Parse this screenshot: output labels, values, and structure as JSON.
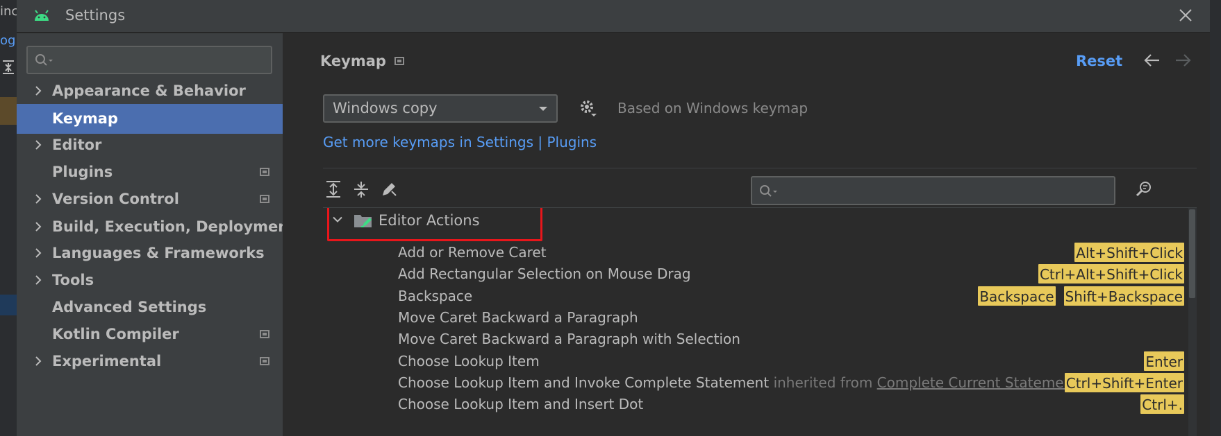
{
  "background": {
    "fragments": [
      "inc",
      "og"
    ]
  },
  "window": {
    "title": "Settings"
  },
  "sidebar": {
    "search_placeholder": "",
    "items": [
      {
        "label": "Appearance & Behavior",
        "expandable": true,
        "selected": false,
        "project_icon": false
      },
      {
        "label": "Keymap",
        "expandable": false,
        "selected": true,
        "project_icon": false
      },
      {
        "label": "Editor",
        "expandable": true,
        "selected": false,
        "project_icon": false
      },
      {
        "label": "Plugins",
        "expandable": false,
        "selected": false,
        "project_icon": true
      },
      {
        "label": "Version Control",
        "expandable": true,
        "selected": false,
        "project_icon": true
      },
      {
        "label": "Build, Execution, Deployment",
        "expandable": true,
        "selected": false,
        "project_icon": false
      },
      {
        "label": "Languages & Frameworks",
        "expandable": true,
        "selected": false,
        "project_icon": false
      },
      {
        "label": "Tools",
        "expandable": true,
        "selected": false,
        "project_icon": false
      },
      {
        "label": "Advanced Settings",
        "expandable": false,
        "selected": false,
        "project_icon": false
      },
      {
        "label": "Kotlin Compiler",
        "expandable": false,
        "selected": false,
        "project_icon": true
      },
      {
        "label": "Experimental",
        "expandable": true,
        "selected": false,
        "project_icon": true
      }
    ]
  },
  "main": {
    "heading": "Keymap",
    "reset_label": "Reset",
    "keymap_select": "Windows copy",
    "based_on": "Based on Windows keymap",
    "get_more_link": "Get more keymaps in Settings | Plugins",
    "tree_search_placeholder": "",
    "group": {
      "label": "Editor Actions",
      "expanded": true
    },
    "actions": [
      {
        "name": "Add or Remove Caret",
        "inherited": "",
        "inherited_from": "",
        "keys": [
          "Alt+Shift+Click"
        ]
      },
      {
        "name": "Add Rectangular Selection on Mouse Drag",
        "inherited": "",
        "inherited_from": "",
        "keys": [
          "Ctrl+Alt+Shift+Click"
        ]
      },
      {
        "name": "Backspace",
        "inherited": "",
        "inherited_from": "",
        "keys": [
          "Backspace",
          "Shift+Backspace"
        ]
      },
      {
        "name": "Move Caret Backward a Paragraph",
        "inherited": "",
        "inherited_from": "",
        "keys": []
      },
      {
        "name": "Move Caret Backward a Paragraph with Selection",
        "inherited": "",
        "inherited_from": "",
        "keys": []
      },
      {
        "name": "Choose Lookup Item",
        "inherited": "",
        "inherited_from": "",
        "keys": [
          "Enter"
        ]
      },
      {
        "name": "Choose Lookup Item and Invoke Complete Statement",
        "inherited": "inherited from",
        "inherited_from": "Complete Current Statemen",
        "keys": [
          "Ctrl+Shift+Enter"
        ]
      },
      {
        "name": "Choose Lookup Item and Insert Dot",
        "inherited": "",
        "inherited_from": "",
        "keys": [
          "Ctrl+."
        ]
      }
    ]
  },
  "colors": {
    "accent": "#589df6",
    "selection": "#4b6eaf",
    "shortcut_bg": "#e8c95a",
    "highlight_box": "#e8161b"
  }
}
